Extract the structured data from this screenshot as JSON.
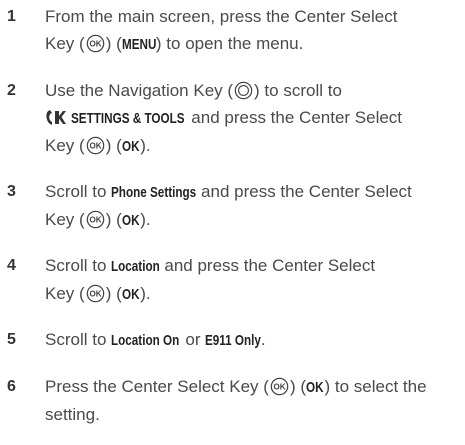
{
  "steps": [
    {
      "num": "1",
      "line1": "From the main screen, press the Center Select",
      "line2_pre": "Key (",
      "line2_post": ") (",
      "menu_label": "MENU",
      "line2_end": ") to open the menu."
    },
    {
      "num": "2",
      "line1_pre": "Use the Navigation Key (",
      "line1_post": ") to scroll to",
      "settings_label": "SETTINGS & TOOLS",
      "line2_post": " and press the Center Select",
      "line3_pre": "Key (",
      "line3_mid": ") (",
      "ok_label": "OK",
      "line3_end": ")."
    },
    {
      "num": "3",
      "pre": "Scroll to ",
      "target_label": "Phone Settings",
      "post": " and press the Center Select",
      "line2_pre": "Key (",
      "line2_mid": ") (",
      "ok_label": "OK",
      "line2_end": ")."
    },
    {
      "num": "4",
      "pre": "Scroll to ",
      "target_label": "Location",
      "post": " and press the Center Select",
      "line2_pre": "Key (",
      "line2_mid": ") (",
      "ok_label": "OK",
      "line2_end": ")."
    },
    {
      "num": "5",
      "pre": "Scroll to ",
      "option1_label": "Location On",
      "mid": " or ",
      "option2_label": "E911 Only",
      "end": "."
    },
    {
      "num": "6",
      "pre": "Press the Center Select Key (",
      "mid": ") (",
      "ok_label": "OK",
      "post": ") to select the",
      "line2": "setting."
    }
  ],
  "icons": {
    "center_select_key": "ok-key-icon",
    "navigation_key": "navigation-key-icon",
    "settings_tools": "settings-tools-icon"
  }
}
